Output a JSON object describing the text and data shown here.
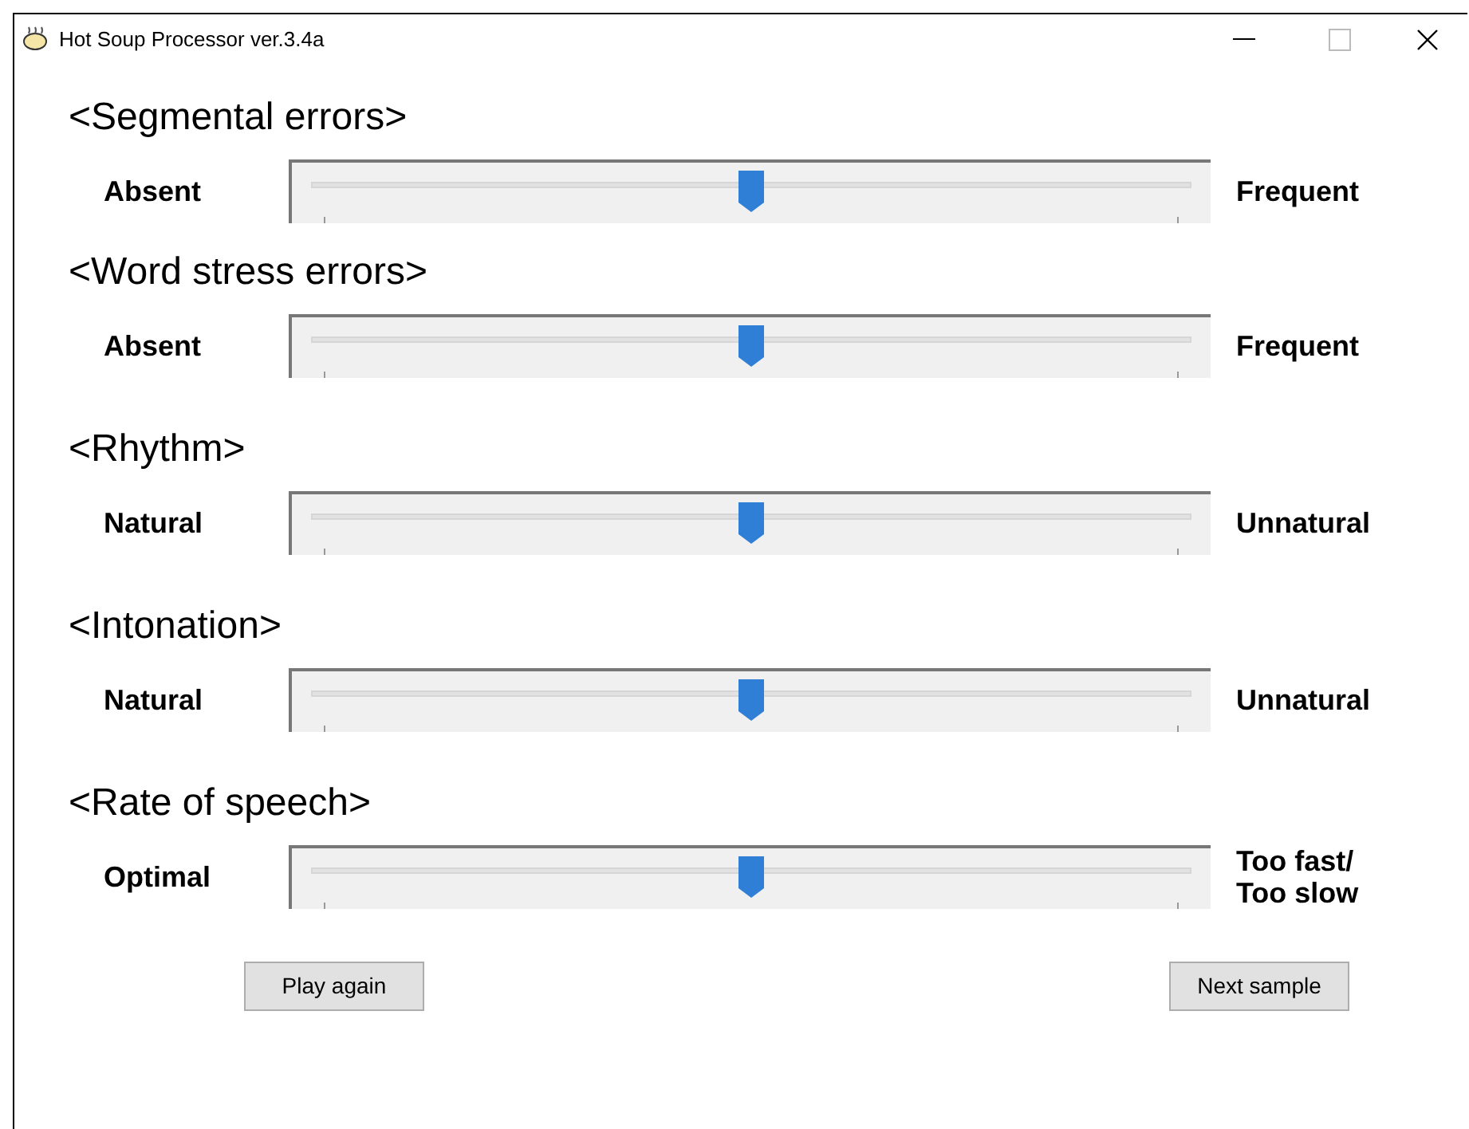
{
  "window": {
    "title": "Hot Soup Processor ver.3.4a"
  },
  "scales": [
    {
      "heading": "<Segmental errors>",
      "left": "Absent",
      "right": "Frequent",
      "level": 0.5
    },
    {
      "heading": "<Word stress errors>",
      "left": "Absent",
      "right": "Frequent",
      "level": 0.5
    },
    {
      "heading": "<Rhythm>",
      "left": "Natural",
      "right": "Unnatural",
      "level": 0.5
    },
    {
      "heading": "<Intonation>",
      "left": "Natural",
      "right": "Unnatural",
      "level": 0.5
    },
    {
      "heading": "<Rate of speech>",
      "left": "Optimal",
      "right": "Too fast/\nToo slow",
      "level": 0.5
    }
  ],
  "buttons": [
    "Play again",
    "Next sample"
  ]
}
